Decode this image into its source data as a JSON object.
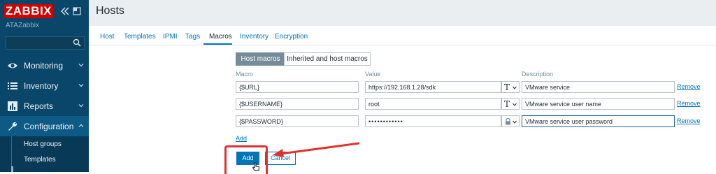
{
  "brand": {
    "logo": "ZABBIX",
    "server": "ATAZabbix"
  },
  "sidebar": {
    "menu": [
      {
        "label": "Monitoring",
        "icon": "eye-icon"
      },
      {
        "label": "Inventory",
        "icon": "list-icon"
      },
      {
        "label": "Reports",
        "icon": "bar-chart-icon"
      },
      {
        "label": "Configuration",
        "icon": "wrench-icon"
      }
    ],
    "submenu": [
      {
        "label": "Host groups"
      },
      {
        "label": "Templates"
      }
    ]
  },
  "page": {
    "title": "Hosts"
  },
  "tabs": [
    {
      "label": "Host"
    },
    {
      "label": "Templates"
    },
    {
      "label": "IPMI"
    },
    {
      "label": "Tags"
    },
    {
      "label": "Macros",
      "active": true
    },
    {
      "label": "Inventory"
    },
    {
      "label": "Encryption"
    }
  ],
  "subtabs": {
    "host_macros": "Host macros",
    "inherited": "Inherited and host macros"
  },
  "columns": {
    "macro": "Macro",
    "value": "Value",
    "description": "Description"
  },
  "macros": [
    {
      "macro": "{$URL}",
      "value": "https://192.168.1.28/sdk",
      "type": "text",
      "description": "VMware service",
      "remove": "Remove"
    },
    {
      "macro": "{$USERNAME}",
      "value": "root",
      "type": "text",
      "description": "VMware service user name",
      "remove": "Remove"
    },
    {
      "macro": "{$PASSWORD}",
      "value": "••••••••••••",
      "type": "secret",
      "description": "VMware service user password",
      "remove": "Remove"
    }
  ],
  "add_link": "Add",
  "buttons": {
    "add": "Add",
    "cancel": "Cancel"
  },
  "colors": {
    "sidebar": "#0a466a",
    "accent": "#0275b8",
    "logo": "#d40000",
    "annotation": "#e03131"
  }
}
